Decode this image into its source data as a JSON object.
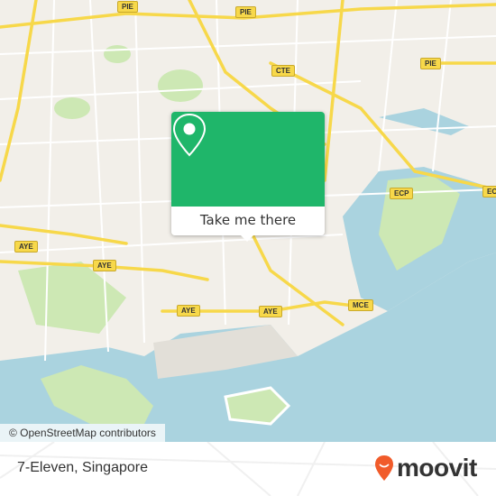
{
  "map": {
    "road_labels": [
      "PIE",
      "PIE",
      "PIE",
      "CTE",
      "ECP",
      "EC",
      "AYE",
      "AYE",
      "AYE",
      "AYE",
      "MCE"
    ],
    "colors": {
      "land": "#f2efe9",
      "water": "#aad3df",
      "park": "#cde8b4",
      "highway": "#f7d84a",
      "accent": "#1fb66a"
    }
  },
  "popup": {
    "icon": "map-pin-icon",
    "button_label": "Take me there"
  },
  "attribution": "© OpenStreetMap contributors",
  "footer": {
    "place_name": "7-Eleven, Singapore",
    "logo_text": "moovit",
    "logo_icon": "moovit-pin-icon",
    "logo_color": "#f15b2a"
  }
}
